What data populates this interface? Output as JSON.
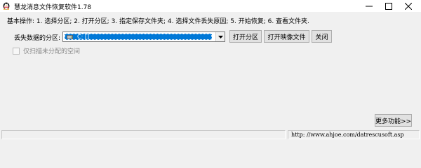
{
  "window": {
    "title": "慧龙消息文件恢复软件1.78",
    "icon": "penguin-app-icon",
    "controls": [
      "minimize-icon",
      "maximize-icon",
      "close-icon"
    ]
  },
  "instructions": "基本操作: 1. 选择分区; 2. 打开分区; 3. 指定保存文件夹; 4. 选择文件丢失原因; 5. 开始恢复; 6. 查看文件夹.",
  "partition": {
    "label": "丢失数据的分区:",
    "selected": "C: []"
  },
  "buttons": {
    "open_partition": "打开分区",
    "open_image": "打开映像文件",
    "close": "关闭",
    "more": "更多功能>>"
  },
  "checkbox": {
    "label": "仅扫描未分配的空间",
    "checked": false,
    "enabled": false
  },
  "statusbar": {
    "pane1": "",
    "url": "http: //www.ahjoe.com/datrescusoft.asp"
  },
  "colors": {
    "window_bg": "#f0f0f0",
    "selection": "#0078d7",
    "disabled_text": "#8a8a8a"
  }
}
